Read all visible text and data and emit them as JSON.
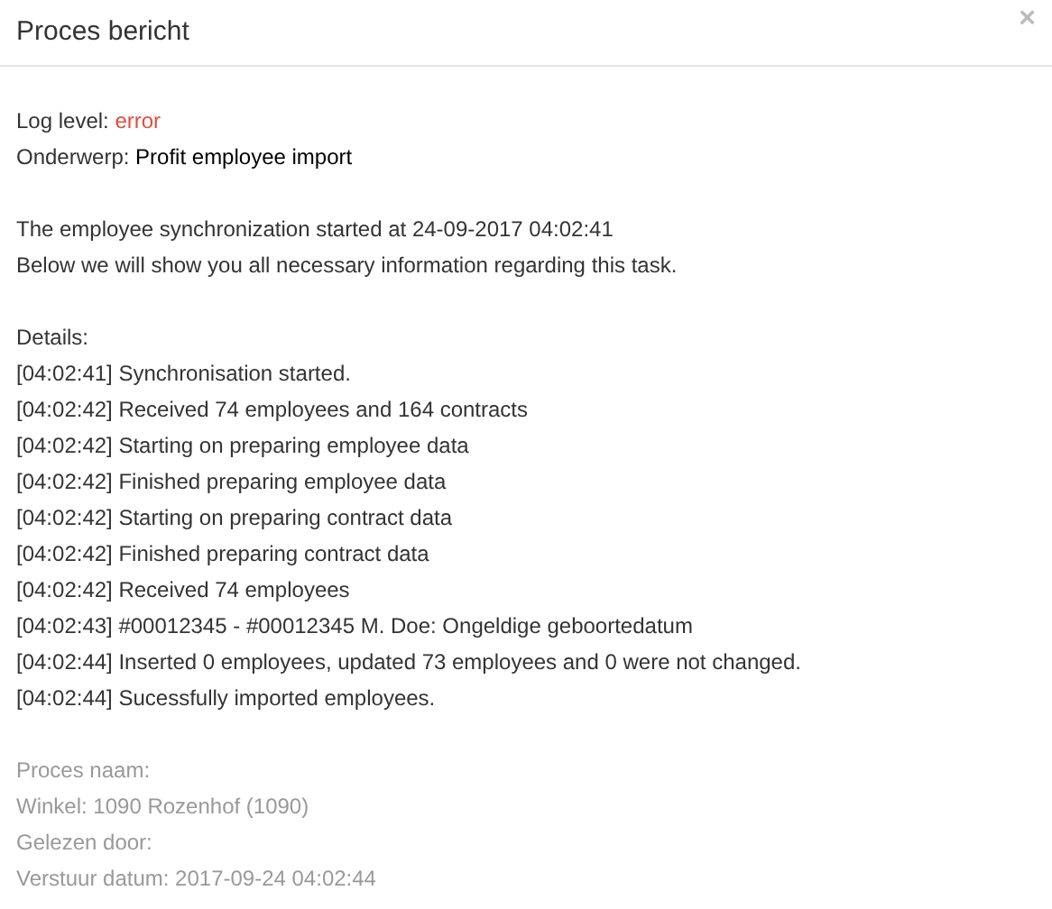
{
  "dialog": {
    "title": "Proces bericht",
    "close": "×"
  },
  "meta": [
    {
      "kind": "level",
      "label": "Log level:",
      "value": "error"
    },
    {
      "kind": "plain",
      "label": "Onderwerp:",
      "value": "Profit employee import"
    }
  ],
  "intro": [
    "The employee synchronization started at 24-09-2017 04:02:41",
    "Below we will show you all necessary information regarding this task."
  ],
  "details_heading": "Details:",
  "log": [
    {
      "time": "[04:02:41]",
      "message": "Synchronisation started."
    },
    {
      "time": "[04:02:42]",
      "message": "Received 74 employees and 164 contracts"
    },
    {
      "time": "[04:02:42]",
      "message": "Starting on preparing employee data"
    },
    {
      "time": "[04:02:42]",
      "message": "Finished preparing employee data"
    },
    {
      "time": "[04:02:42]",
      "message": "Starting on preparing contract data"
    },
    {
      "time": "[04:02:42]",
      "message": "Finished preparing contract data"
    },
    {
      "time": "[04:02:42]",
      "message": "Received 74 employees"
    },
    {
      "time": "[04:02:43]",
      "message": "#00012345 - #00012345 M. Doe: Ongeldige geboortedatum"
    },
    {
      "time": "[04:02:44]",
      "message": "Inserted 0 employees, updated 73 employees and 0 were not changed."
    },
    {
      "time": "[04:02:44]",
      "message": "Sucessfully imported employees."
    }
  ],
  "footer": [
    "Proces naam:",
    "Winkel: 1090 Rozenhof (1090)",
    "Gelezen door:",
    "Verstuur datum: 2017-09-24 04:02:44"
  ]
}
